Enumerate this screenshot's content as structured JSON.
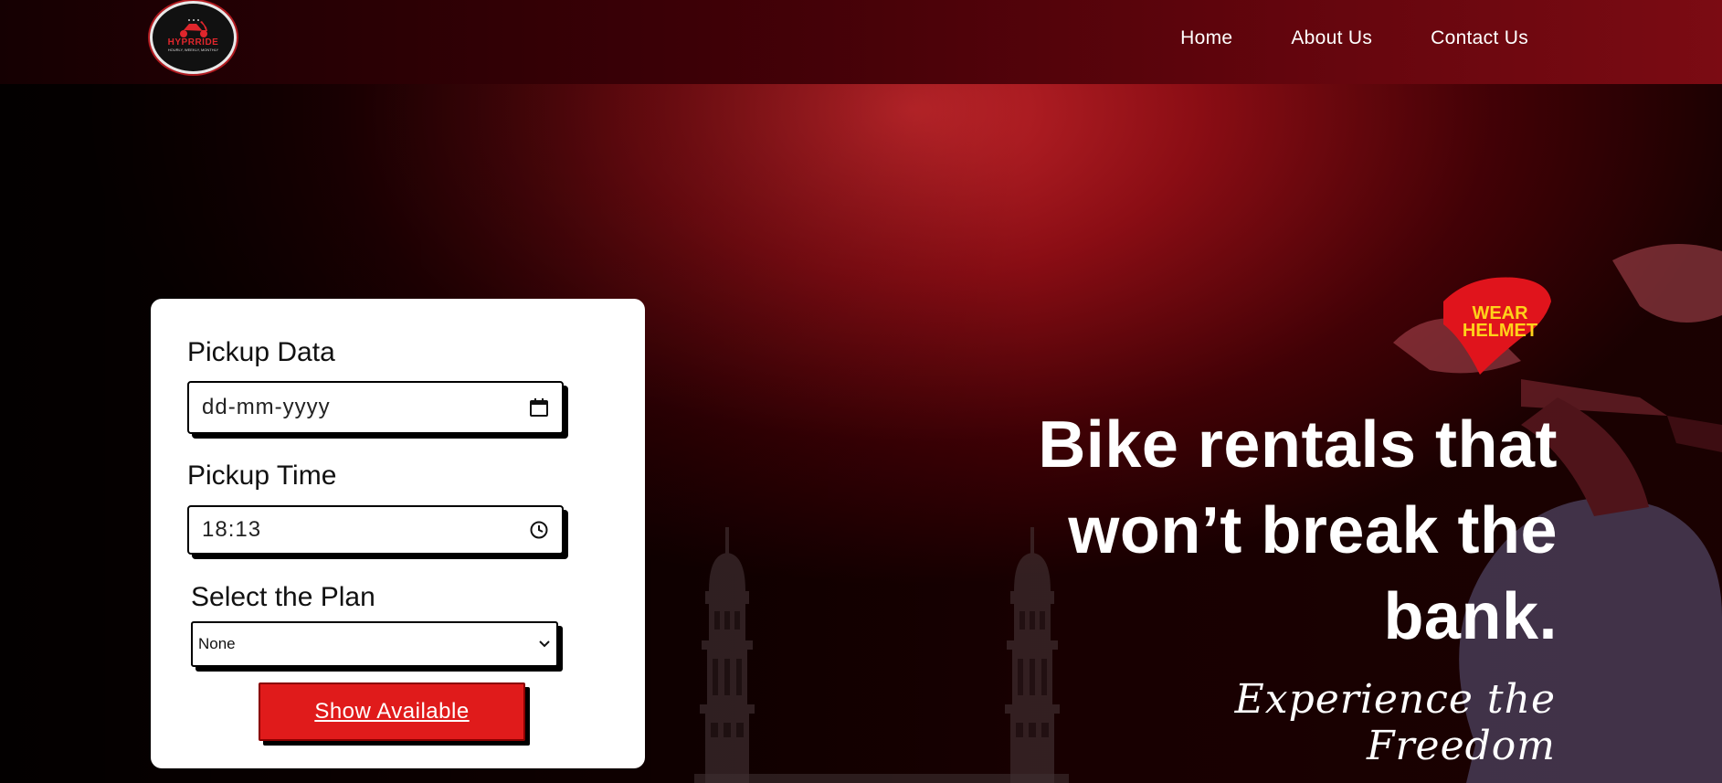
{
  "header": {
    "logo": {
      "brand": "HYPRRIDE",
      "sub": "HOURLY, WEEKLY, MONTHLY"
    },
    "nav": [
      {
        "label": "Home"
      },
      {
        "label": "About Us"
      },
      {
        "label": "Contact Us"
      }
    ]
  },
  "form": {
    "date_label": "Pickup Data",
    "date_value": "dd-mm-yyyy",
    "time_label": "Pickup Time",
    "time_value": "18:13",
    "plan_label": "Select the Plan",
    "plan_selected": "None",
    "submit_label": "Show Available"
  },
  "hero": {
    "headline_lines": [
      "Bike rentals that",
      "won’t break the",
      "bank."
    ],
    "tagline": "Experience the Freedom",
    "badge": [
      "WEAR",
      "HELMET"
    ]
  },
  "colors": {
    "accent": "#e01b1b",
    "badge_red": "#e0141c",
    "badge_text": "#ffd21a"
  }
}
